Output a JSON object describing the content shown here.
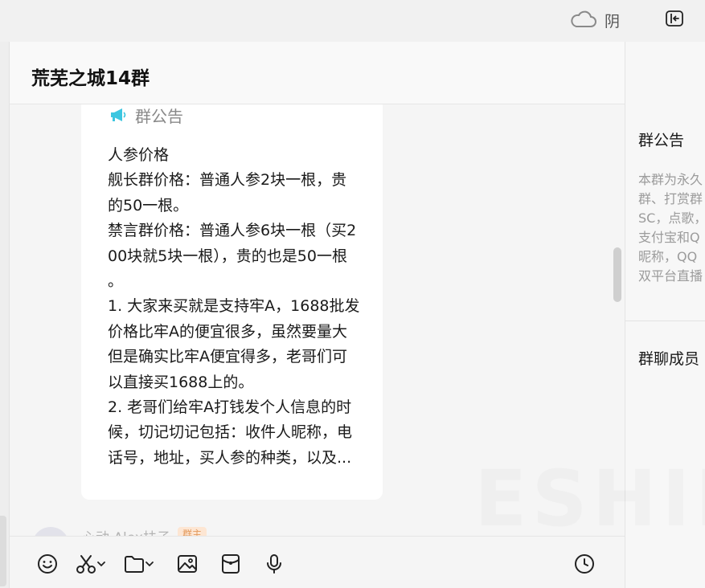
{
  "topbar": {
    "weather_icon": "cloud-icon",
    "weather_text": "阴",
    "exit_icon": "sidebar-exit-icon"
  },
  "chat": {
    "title": "荒芜之城14群",
    "announcement": {
      "label": "群公告",
      "icon": "megaphone-icon",
      "icon_color": "#3cc6e0",
      "lines": [
        "人参价格",
        "舰长群价格：普通人参2块一根，贵",
        "的50一根。",
        "禁言群价格：普通人参6块一根（买2",
        "00块就5块一根），贵的也是50一根",
        "。",
        "1. 大家来买就是支持牢A，1688批发",
        "价格比牢A的便宜很多，虽然要量大",
        "但是确实比牢A便宜得多，老哥们可",
        "以直接买1688上的。",
        "2. 老哥们给牢A打钱发个人信息的时",
        "候，切记切记包括：收件人昵称，电",
        "话号，地址，买人参的种类，以及..."
      ]
    },
    "next_message": {
      "sender": "心动 Alex扶子",
      "badge": "群主"
    }
  },
  "toolbar": {
    "tools": [
      "emoji-icon",
      "scissors-icon",
      "folder-icon",
      "image-icon",
      "red-packet-icon",
      "microphone-icon",
      "history-icon"
    ]
  },
  "right_panel": {
    "notice_title": "群公告",
    "notice_lines": [
      "本群为永久",
      "群、打赏群",
      "SC，点歌，",
      "支付宝和Q",
      "昵称，QQ",
      "双平台直播"
    ],
    "members_title": "群聊成员"
  }
}
